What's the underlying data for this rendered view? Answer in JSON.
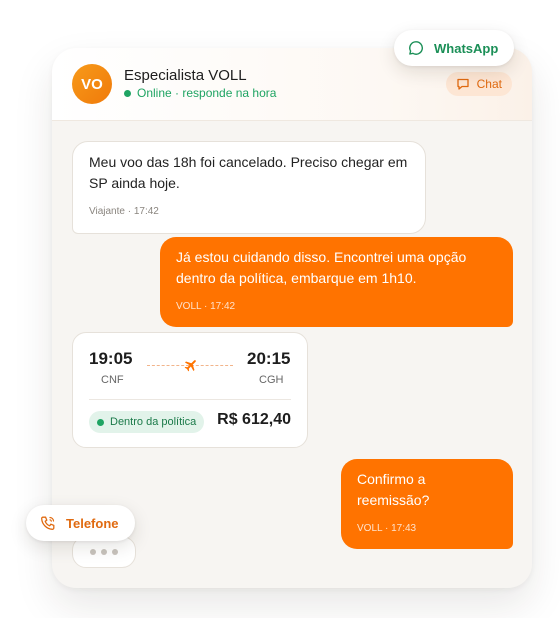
{
  "header": {
    "avatar_initials": "VO",
    "name": "Especialista VOLL",
    "status": "Online · responde na hora",
    "chat_chip": "Chat"
  },
  "pills": {
    "whatsapp": "WhatsApp",
    "telefone": "Telefone"
  },
  "messages": [
    {
      "from": "traveler",
      "text": "Meu voo das 18h foi cancelado. Preciso chegar em SP ainda hoje.",
      "meta": "Viajante · 17:42"
    },
    {
      "from": "voll",
      "text": "Já estou cuidando disso. Encontrei uma opção dentro da política, embarque em 1h10.",
      "meta": "VOLL · 17:42"
    },
    {
      "from": "voll",
      "text": "Confirmo a reemissão?",
      "meta": "VOLL · 17:43"
    }
  ],
  "flight": {
    "depart_time": "19:05",
    "depart_code": "CNF",
    "arrive_time": "20:15",
    "arrive_code": "CGH",
    "policy_badge": "Dentro da política",
    "price": "R$ 612,40"
  },
  "colors": {
    "accent": "#ff7300",
    "online": "#1fa463",
    "whatsapp": "#1b8f57",
    "card_bg": "#f7f5f2"
  }
}
